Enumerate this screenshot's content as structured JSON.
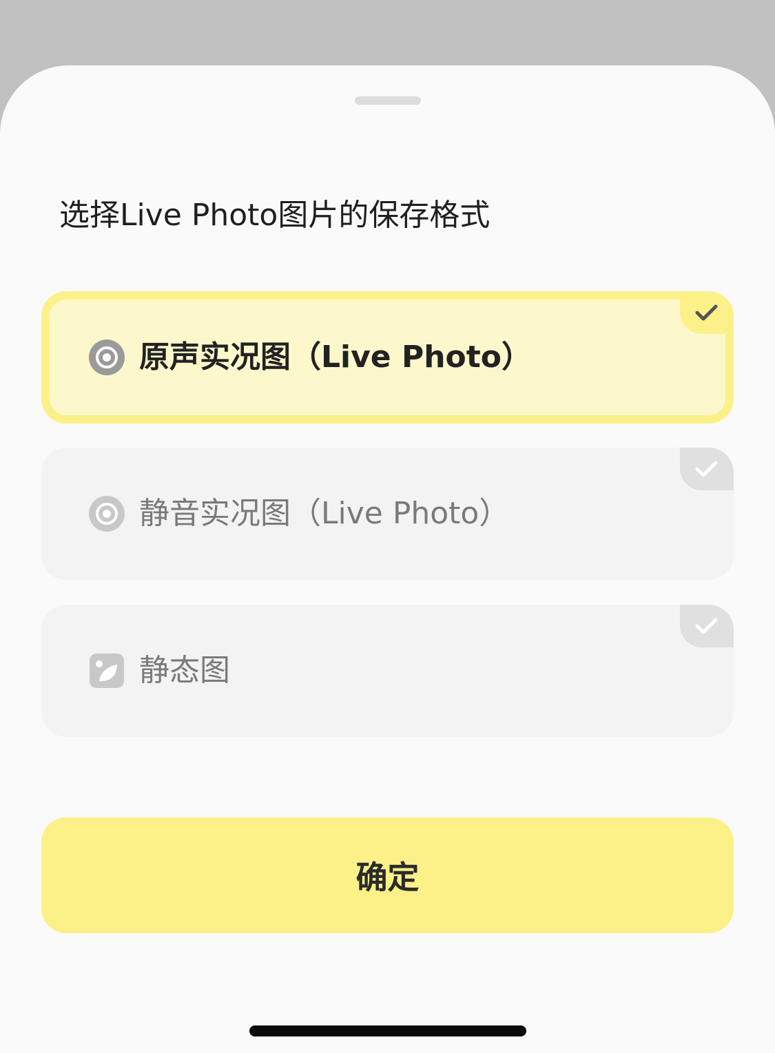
{
  "sheet": {
    "title": "选择Live Photo图片的保存格式"
  },
  "options": [
    {
      "label": "原声实况图（Live Photo）",
      "icon": "live-photo-icon",
      "selected": true
    },
    {
      "label": "静音实况图（Live Photo）",
      "icon": "live-photo-icon",
      "selected": false
    },
    {
      "label": "静态图",
      "icon": "image-icon",
      "selected": false
    }
  ],
  "confirm_label": "确定",
  "colors": {
    "accent": "#fcf089",
    "selected_bg": "#fdf8cc",
    "unselected_bg": "#f3f3f3"
  }
}
